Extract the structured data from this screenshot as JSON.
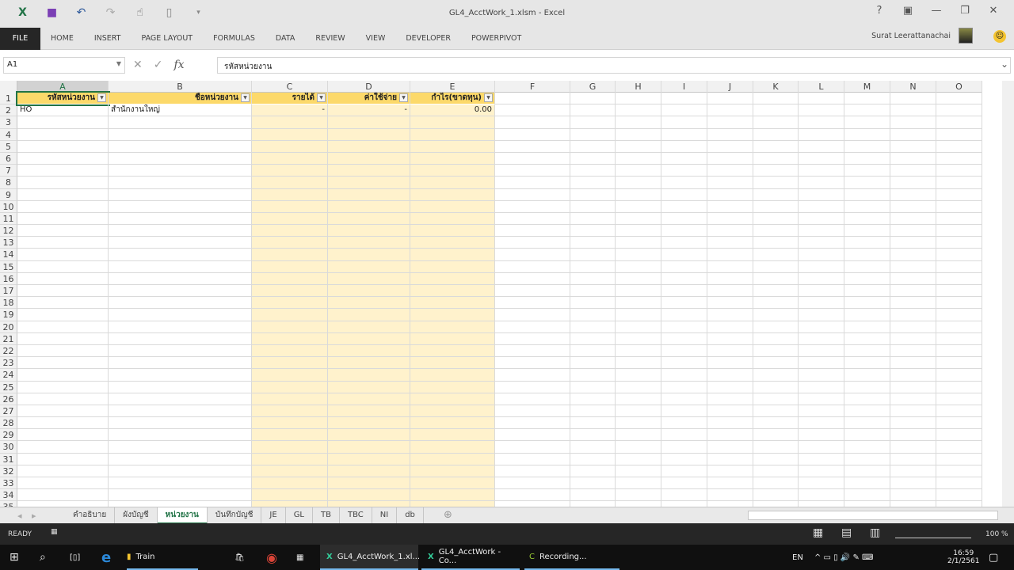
{
  "window": {
    "title": "GL4_AcctWork_1.xlsm - Excel",
    "user": "Surat Leerattanachai"
  },
  "qat": [
    "excel-logo",
    "save",
    "undo",
    "redo",
    "touch-mode",
    "new-file",
    "customize"
  ],
  "ribbon_tabs": [
    "FILE",
    "HOME",
    "INSERT",
    "PAGE LAYOUT",
    "FORMULAS",
    "DATA",
    "REVIEW",
    "VIEW",
    "DEVELOPER",
    "POWERPIVOT"
  ],
  "formula_bar": {
    "name_box": "A1",
    "formula": "รหัสหน่วยงาน",
    "fx": "fx"
  },
  "columns": [
    {
      "l": "A"
    },
    {
      "l": "B"
    },
    {
      "l": "C"
    },
    {
      "l": "D"
    },
    {
      "l": "E"
    },
    {
      "l": "F"
    },
    {
      "l": "G"
    },
    {
      "l": "H"
    },
    {
      "l": "I"
    },
    {
      "l": "J"
    },
    {
      "l": "K"
    },
    {
      "l": "L"
    },
    {
      "l": "M"
    },
    {
      "l": "N"
    },
    {
      "l": "O"
    }
  ],
  "table": {
    "headers": [
      "รหัสหน่วยงาน",
      "ชื่อหน่วยงาน",
      "รายได้",
      "ค่าใช้จ่าย",
      "กำไร(ขาดทุน)"
    ],
    "rows": [
      [
        "HO",
        "สำนักงานใหญ่",
        "-",
        "-",
        "0.00"
      ]
    ]
  },
  "row_count": 35,
  "sheet_tabs": [
    "คำอธิบาย",
    "ผังบัญชี",
    "หน่วยงาน",
    "บันทึกบัญชี",
    "JE",
    "GL",
    "TB",
    "TBC",
    "NI",
    "db"
  ],
  "active_sheet": "หน่วยงาน",
  "status": {
    "mode": "READY",
    "zoom": "100 %"
  },
  "taskbar": {
    "items": [
      "Train",
      "GL4_AcctWork_1.xl...",
      "GL4_AcctWork - Co...",
      "Recording..."
    ],
    "lang": "EN",
    "time": "16:59",
    "date": "2/1/2561"
  }
}
